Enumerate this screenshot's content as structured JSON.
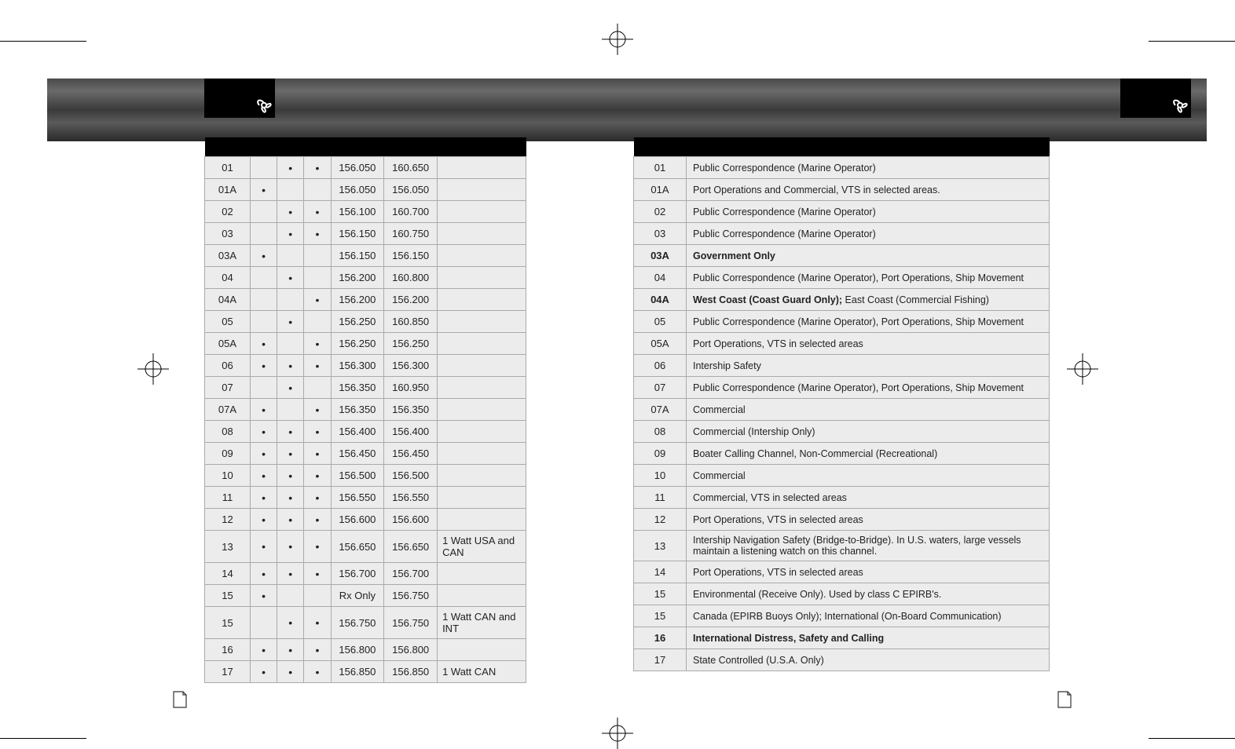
{
  "chart_data": {
    "type": "table",
    "left_table": {
      "header_cols": 7,
      "rows": [
        {
          "ch": "01",
          "a": "",
          "b": "•",
          "c": "•",
          "tx": "156.050",
          "rx": "160.650",
          "note": ""
        },
        {
          "ch": "01A",
          "a": "•",
          "b": "",
          "c": "",
          "tx": "156.050",
          "rx": "156.050",
          "note": ""
        },
        {
          "ch": "02",
          "a": "",
          "b": "•",
          "c": "•",
          "tx": "156.100",
          "rx": "160.700",
          "note": ""
        },
        {
          "ch": "03",
          "a": "",
          "b": "•",
          "c": "•",
          "tx": "156.150",
          "rx": "160.750",
          "note": ""
        },
        {
          "ch": "03A",
          "a": "•",
          "b": "",
          "c": "",
          "tx": "156.150",
          "rx": "156.150",
          "note": ""
        },
        {
          "ch": "04",
          "a": "",
          "b": "•",
          "c": "",
          "tx": "156.200",
          "rx": "160.800",
          "note": ""
        },
        {
          "ch": "04A",
          "a": "",
          "b": "",
          "c": "•",
          "tx": "156.200",
          "rx": "156.200",
          "note": ""
        },
        {
          "ch": "05",
          "a": "",
          "b": "•",
          "c": "",
          "tx": "156.250",
          "rx": "160.850",
          "note": ""
        },
        {
          "ch": "05A",
          "a": "•",
          "b": "",
          "c": "•",
          "tx": "156.250",
          "rx": "156.250",
          "note": ""
        },
        {
          "ch": "06",
          "a": "•",
          "b": "•",
          "c": "•",
          "tx": "156.300",
          "rx": "156.300",
          "note": ""
        },
        {
          "ch": "07",
          "a": "",
          "b": "•",
          "c": "",
          "tx": "156.350",
          "rx": "160.950",
          "note": ""
        },
        {
          "ch": "07A",
          "a": "•",
          "b": "",
          "c": "•",
          "tx": "156.350",
          "rx": "156.350",
          "note": ""
        },
        {
          "ch": "08",
          "a": "•",
          "b": "•",
          "c": "•",
          "tx": "156.400",
          "rx": "156.400",
          "note": ""
        },
        {
          "ch": "09",
          "a": "•",
          "b": "•",
          "c": "•",
          "tx": "156.450",
          "rx": "156.450",
          "note": ""
        },
        {
          "ch": "10",
          "a": "•",
          "b": "•",
          "c": "•",
          "tx": "156.500",
          "rx": "156.500",
          "note": ""
        },
        {
          "ch": "11",
          "a": "•",
          "b": "•",
          "c": "•",
          "tx": "156.550",
          "rx": "156.550",
          "note": ""
        },
        {
          "ch": "12",
          "a": "•",
          "b": "•",
          "c": "•",
          "tx": "156.600",
          "rx": "156.600",
          "note": ""
        },
        {
          "ch": "13",
          "a": "•",
          "b": "•",
          "c": "•",
          "tx": "156.650",
          "rx": "156.650",
          "note": "1 Watt USA and CAN"
        },
        {
          "ch": "14",
          "a": "•",
          "b": "•",
          "c": "•",
          "tx": "156.700",
          "rx": "156.700",
          "note": ""
        },
        {
          "ch": "15",
          "a": "•",
          "b": "",
          "c": "",
          "tx": "Rx Only",
          "rx": "156.750",
          "note": ""
        },
        {
          "ch": "15",
          "a": "",
          "b": "•",
          "c": "•",
          "tx": "156.750",
          "rx": "156.750",
          "note": "1 Watt CAN and INT"
        },
        {
          "ch": "16",
          "a": "•",
          "b": "•",
          "c": "•",
          "tx": "156.800",
          "rx": "156.800",
          "note": ""
        },
        {
          "ch": "17",
          "a": "•",
          "b": "•",
          "c": "•",
          "tx": "156.850",
          "rx": "156.850",
          "note": "1 Watt CAN"
        }
      ]
    },
    "right_table": {
      "header_cols": 2,
      "rows": [
        {
          "ch": "01",
          "desc": "Public Correspondence (Marine Operator)",
          "bold": false
        },
        {
          "ch": "01A",
          "desc": "Port Operations and Commercial, VTS in selected areas.",
          "bold": false
        },
        {
          "ch": "02",
          "desc": "Public Correspondence (Marine Operator)",
          "bold": false
        },
        {
          "ch": "03",
          "desc": "Public Correspondence (Marine Operator)",
          "bold": false
        },
        {
          "ch": "03A",
          "desc": "Government Only",
          "bold": true
        },
        {
          "ch": "04",
          "desc": "Public Correspondence (Marine Operator), Port Operations, Ship Movement",
          "bold": false
        },
        {
          "ch": "04A",
          "desc": "West Coast (Coast Guard Only); East Coast (Commercial Fishing)",
          "bold": true,
          "partial_bold": "West Coast (Coast Guard Only);"
        },
        {
          "ch": "05",
          "desc": "Public Correspondence (Marine Operator), Port Operations, Ship Movement",
          "bold": false
        },
        {
          "ch": "05A",
          "desc": "Port Operations, VTS in selected areas",
          "bold": false
        },
        {
          "ch": "06",
          "desc": "Intership Safety",
          "bold": false
        },
        {
          "ch": "07",
          "desc": "Public Correspondence (Marine Operator), Port Operations, Ship Movement",
          "bold": false
        },
        {
          "ch": "07A",
          "desc": "Commercial",
          "bold": false
        },
        {
          "ch": "08",
          "desc": "Commercial (Intership Only)",
          "bold": false
        },
        {
          "ch": "09",
          "desc": "Boater Calling Channel, Non-Commercial (Recreational)",
          "bold": false
        },
        {
          "ch": "10",
          "desc": "Commercial",
          "bold": false
        },
        {
          "ch": "11",
          "desc": "Commercial, VTS in selected areas",
          "bold": false
        },
        {
          "ch": "12",
          "desc": "Port Operations, VTS in selected areas",
          "bold": false
        },
        {
          "ch": "13",
          "desc": "Intership Navigation Safety (Bridge-to-Bridge). In U.S. waters, large vessels maintain a listening watch on this channel.",
          "bold": false
        },
        {
          "ch": "14",
          "desc": "Port Operations, VTS in selected areas",
          "bold": false
        },
        {
          "ch": "15",
          "desc": "Environmental (Receive Only). Used by class C EPIRB's.",
          "bold": false
        },
        {
          "ch": "15",
          "desc": "Canada (EPIRB Buoys Only); International (On-Board Communication)",
          "bold": false
        },
        {
          "ch": "16",
          "desc": "International Distress, Safety and Calling",
          "bold": true
        },
        {
          "ch": "17",
          "desc": "State Controlled (U.S.A. Only)",
          "bold": false
        }
      ]
    }
  }
}
